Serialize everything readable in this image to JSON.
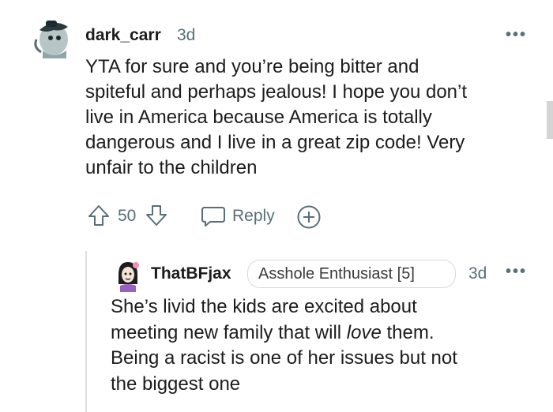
{
  "comment": {
    "username": "dark_carr",
    "age": "3d",
    "text_lines": [
      "YTA for sure and you’re being bitter and",
      "spiteful and perhaps jealous! I hope you don’t",
      "live in America because America is totally",
      "dangerous and I live in a great zip code! Very",
      "unfair to the children"
    ],
    "score": "50",
    "reply_label": "Reply",
    "more_label": "•••"
  },
  "reply": {
    "username": "ThatBFjax",
    "flair": "Asshole Enthusiast [5]",
    "age": "3d",
    "more_label": "•••",
    "text_line1": "She’s livid the kids are excited about",
    "text_line2_pre": "meeting new family that will ",
    "text_line2_em": "love",
    "text_line2_post": " them.",
    "text_line3": "Being a racist is one of her issues but not",
    "text_line4": "the biggest one"
  },
  "icons": {
    "upvote": "upvote-arrow-icon",
    "downvote": "downvote-arrow-icon",
    "reply": "speech-bubble-icon",
    "award": "plus-circle-icon",
    "more": "ellipsis-icon"
  }
}
